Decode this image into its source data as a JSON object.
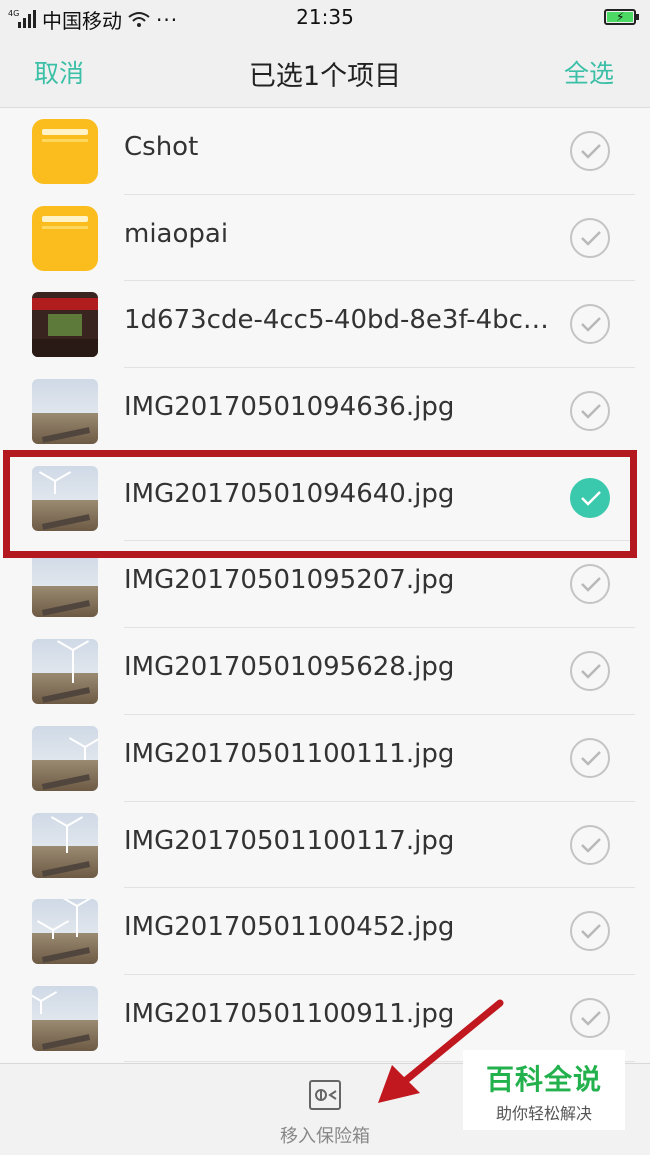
{
  "status_bar": {
    "network": "4G",
    "carrier": "中国移动",
    "more": "···",
    "time": "21:35"
  },
  "header": {
    "cancel_label": "取消",
    "title": "已选1个项目",
    "select_all_label": "全选"
  },
  "colors": {
    "accent": "#3bbfa6",
    "checked": "#3bc9ad",
    "folder": "#fbbd1e",
    "annotation": "#b3191f",
    "watermark_green": "#23b14d"
  },
  "files": [
    {
      "name": "Cshot",
      "kind": "folder-icon",
      "selected": false
    },
    {
      "name": "miaopai",
      "kind": "folder-icon",
      "selected": false
    },
    {
      "name": "1d673cde-4cc5-40bd-8e3f-4bc06...",
      "kind": "photo-thumbnail",
      "selected": false
    },
    {
      "name": "IMG20170501094636.jpg",
      "kind": "photo-thumbnail",
      "selected": false
    },
    {
      "name": "IMG20170501094640.jpg",
      "kind": "photo-thumbnail",
      "selected": true
    },
    {
      "name": "IMG20170501095207.jpg",
      "kind": "photo-thumbnail",
      "selected": false
    },
    {
      "name": "IMG20170501095628.jpg",
      "kind": "photo-thumbnail",
      "selected": false
    },
    {
      "name": "IMG20170501100111.jpg",
      "kind": "photo-thumbnail",
      "selected": false
    },
    {
      "name": "IMG20170501100117.jpg",
      "kind": "photo-thumbnail",
      "selected": false
    },
    {
      "name": "IMG20170501100452.jpg",
      "kind": "photo-thumbnail",
      "selected": false
    },
    {
      "name": "IMG20170501100911.jpg",
      "kind": "photo-thumbnail",
      "selected": false
    }
  ],
  "bottom_bar": {
    "move_to_safe_label": "移入保险箱",
    "icon": "safe-box-icon"
  },
  "watermark": {
    "main": "百科全说",
    "sub": "助你轻松解决"
  }
}
